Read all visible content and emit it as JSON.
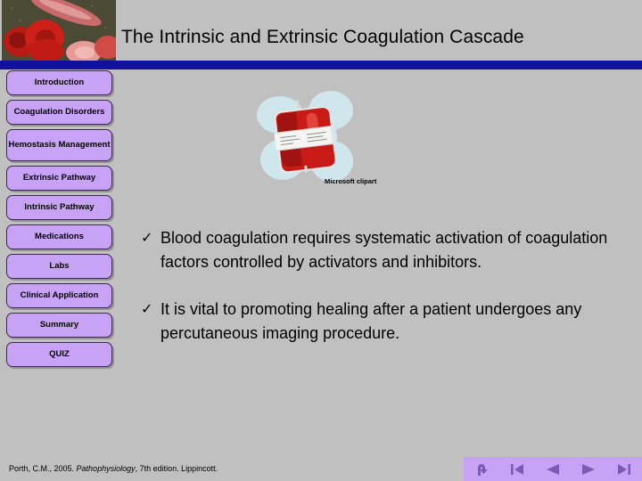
{
  "slide": {
    "title": "The Intrinsic and Extrinsic Coagulation Cascade",
    "background_color": "#c0c0c0",
    "divider_color": "#10119c",
    "accent_color": "#c8a3f5"
  },
  "header_image": {
    "name": "red-blood-cells-micrograph"
  },
  "sidebar": {
    "items": [
      {
        "label": "Introduction",
        "lines": 1
      },
      {
        "label": "Coagulation Disorders",
        "lines": 1
      },
      {
        "label": "Hemostasis Management",
        "lines": 2
      },
      {
        "label": "Extrinsic Pathway",
        "lines": 1
      },
      {
        "label": "Intrinsic Pathway",
        "lines": 1
      },
      {
        "label": "Medications",
        "lines": 1
      },
      {
        "label": "Labs",
        "lines": 1
      },
      {
        "label": "Clinical Application",
        "lines": 1
      },
      {
        "label": "Summary",
        "lines": 1
      },
      {
        "label": "QUIZ",
        "lines": 1
      }
    ]
  },
  "clipart": {
    "caption": "Microsoft clipart",
    "subject": "blood-bag",
    "blob_color": "#cfe6ed",
    "bag_color": "#c81a16"
  },
  "content": {
    "bullet_mark": "✓",
    "bullets": [
      "Blood coagulation requires systematic activation of coagulation factors controlled by activators and inhibitors.",
      "It is vital to promoting healing after a patient undergoes any percutaneous imaging procedure."
    ]
  },
  "footer": {
    "citation_prefix": "Porth, C.M., 2005. ",
    "citation_italic": "Pathophysiology",
    "citation_suffix": ", 7th edition. Lippincott."
  },
  "navigation": {
    "controls": [
      {
        "name": "return-icon",
        "label": "Return"
      },
      {
        "name": "first-slide-icon",
        "label": "First Slide"
      },
      {
        "name": "previous-slide-icon",
        "label": "Previous Slide"
      },
      {
        "name": "next-slide-icon",
        "label": "Next Slide"
      },
      {
        "name": "last-slide-icon",
        "label": "Last Slide"
      }
    ]
  }
}
